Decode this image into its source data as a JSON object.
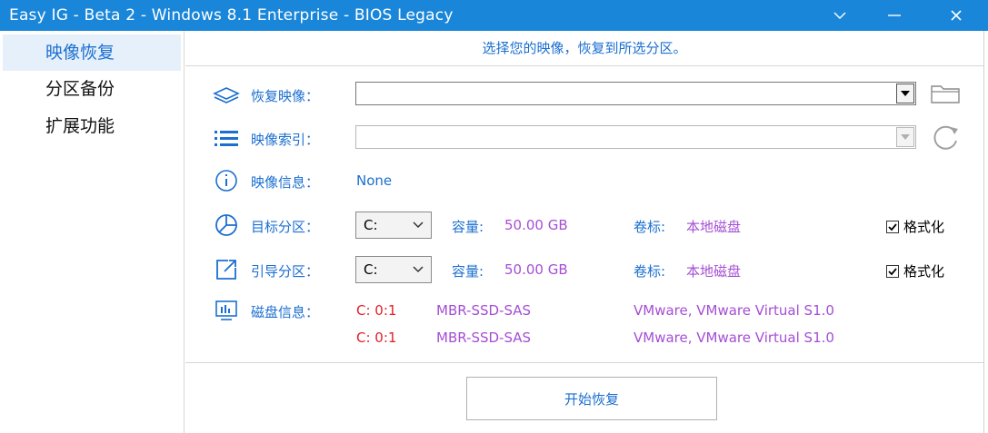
{
  "window": {
    "title": "Easy IG - Beta 2 - Windows 8.1 Enterprise - BIOS Legacy",
    "controls": {
      "menu": "∨",
      "minimize": "—",
      "close": "X"
    }
  },
  "sidebar": {
    "items": [
      {
        "label": "映像恢复",
        "active": true
      },
      {
        "label": "分区备份",
        "active": false
      },
      {
        "label": "扩展功能",
        "active": false
      }
    ]
  },
  "main": {
    "hint": "选择您的映像，恢复到所选分区。",
    "restore_image": {
      "label": "恢复映像：",
      "value": ""
    },
    "image_index": {
      "label": "映像索引：",
      "value": ""
    },
    "image_info": {
      "label": "映像信息：",
      "value": "None"
    },
    "target_partition": {
      "label": "目标分区：",
      "selected": "C:",
      "capacity_label": "容量:",
      "capacity_value": "50.00 GB",
      "volume_label": "卷标:",
      "volume_value": "本地磁盘",
      "format_label": "格式化",
      "format_checked": true
    },
    "boot_partition": {
      "label": "引导分区：",
      "selected": "C:",
      "capacity_label": "容量:",
      "capacity_value": "50.00 GB",
      "volume_label": "卷标:",
      "volume_value": "本地磁盘",
      "format_label": "格式化",
      "format_checked": true
    },
    "disk_info": {
      "label": "磁盘信息：",
      "rows": [
        {
          "id": "C: 0:1",
          "type": "MBR-SSD-SAS",
          "model": "VMware, VMware Virtual S1.0"
        },
        {
          "id": "C: 0:1",
          "type": "MBR-SSD-SAS",
          "model": "VMware, VMware Virtual S1.0"
        }
      ]
    },
    "start_button": "开始恢复"
  },
  "colors": {
    "titlebar": "#1a86d9",
    "accent_blue": "#1b6fd0",
    "purple": "#a54ed4",
    "red": "#e4202a",
    "sidebar_active_bg": "#e6f0fb"
  },
  "icons": {
    "restore_image": "layers-icon",
    "image_index": "list-icon",
    "image_info": "info-icon",
    "target_partition": "pie-chart-icon",
    "boot_partition": "external-link-icon",
    "disk_info": "disk-monitor-icon",
    "browse": "folder-icon",
    "refresh": "refresh-icon"
  }
}
